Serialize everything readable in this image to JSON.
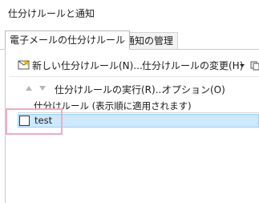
{
  "window": {
    "title": "仕分けルールと通知"
  },
  "tabs": [
    {
      "label": "電子メールの仕分けルール",
      "active": true
    },
    {
      "label": "通知の管理",
      "active": false
    }
  ],
  "toolbar": {
    "new_rule_label": "新しい仕分けルール(N)...",
    "change_rule_label": "仕分けルールの変更(H)",
    "run_rules_label": "仕分けルールの実行(R)...",
    "options_label": "オプション(O)"
  },
  "rules_list": {
    "column_header": "仕分けルール (表示順に適用されます)",
    "rows": [
      {
        "name": "test",
        "checked": false,
        "selected": true
      }
    ]
  },
  "colors": {
    "selection_bg": "#cde8ff",
    "selection_border": "#99d1ff",
    "annotation_highlight": "#f2a9c8"
  }
}
